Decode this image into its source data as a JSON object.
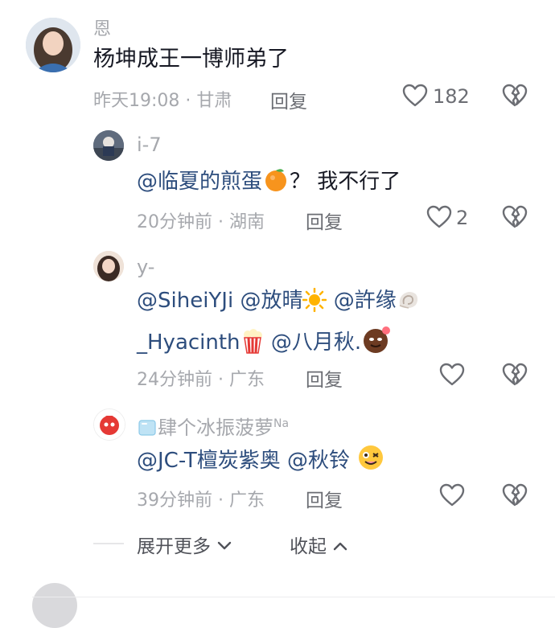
{
  "top_name_fragment": "恩",
  "comment": {
    "text": "杨坤成王一博师弟了",
    "time": "昨天19:08",
    "location": "甘肃",
    "reply_label": "回复",
    "like_count": "182"
  },
  "replies": [
    {
      "username": "i-7",
      "mention": "@临夏的煎蛋",
      "emoji_icon": "tangerine-emoji",
      "text_after": "？ 我不行了",
      "time": "20分钟前",
      "location": "湖南",
      "reply_label": "回复",
      "like_count": "2"
    },
    {
      "username": "y-",
      "line1": [
        "@SiheiYJi",
        "@放晴",
        "@許缘"
      ],
      "line2": [
        "_Hyacinth",
        "@八月秋."
      ],
      "time": "24分钟前",
      "location": "广东",
      "reply_label": "回复"
    },
    {
      "username": "肆个冰振菠萝",
      "username_suffix": "Na",
      "mention1": "@JC-T檀炭紫奥",
      "mention2": "@秋铃",
      "time": "39分钟前",
      "location": "广东",
      "reply_label": "回复"
    }
  ],
  "footer": {
    "expand_label": "展开更多",
    "collapse_label": "收起"
  },
  "colors": {
    "mention": "#2d4d7d",
    "meta": "#a6a8ad"
  }
}
